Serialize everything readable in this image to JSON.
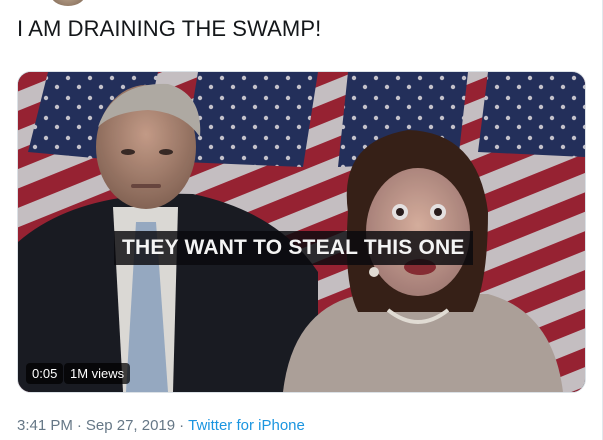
{
  "tweet": {
    "text": "I AM DRAINING THE SWAMP!"
  },
  "video": {
    "caption": "THEY WANT TO STEAL THIS ONE",
    "duration": "0:05",
    "views": "1M views"
  },
  "meta": {
    "time": "3:41 PM",
    "separator": "·",
    "date": "Sep 27, 2019",
    "source": "Twitter for iPhone"
  },
  "colors": {
    "text": "#14171a",
    "meta": "#657786",
    "link": "#1b95e0"
  }
}
